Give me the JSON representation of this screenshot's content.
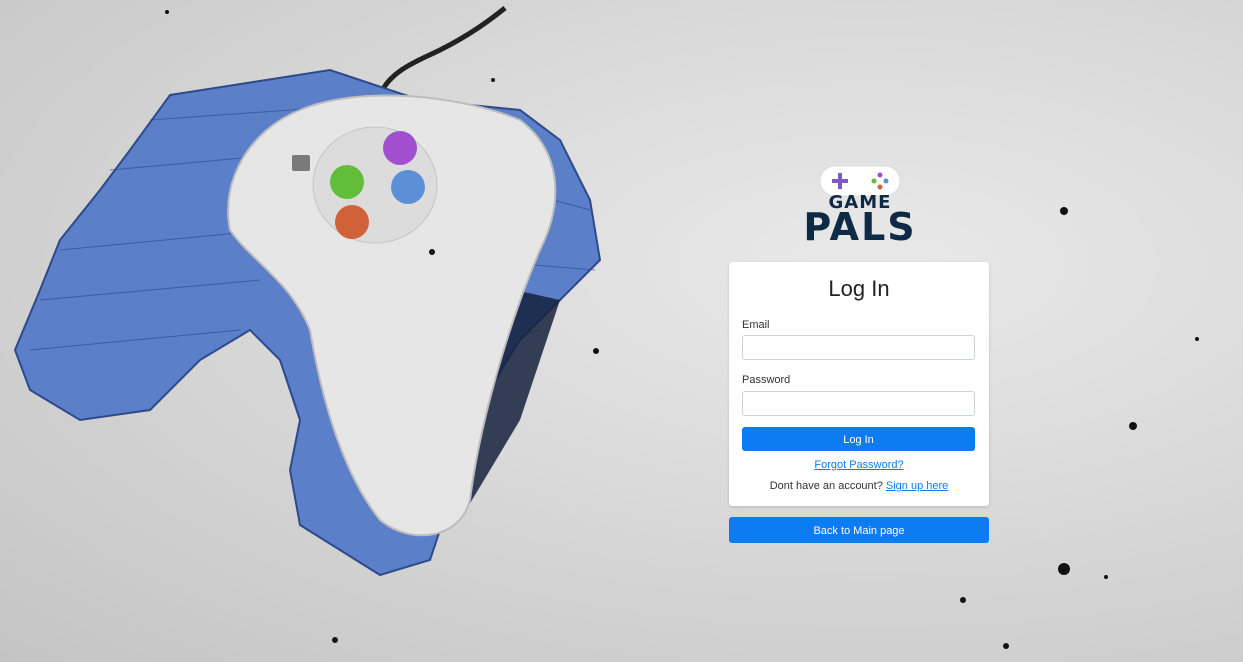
{
  "logo": {
    "line1": "GAME",
    "line2": "PALS"
  },
  "login_card": {
    "title": "Log In",
    "email_label": "Email",
    "email_value": "",
    "password_label": "Password",
    "password_value": "",
    "submit_label": "Log In",
    "forgot_label": "Forgot Password?",
    "signup_prompt": "Dont have an account?",
    "signup_link": "Sign up here"
  },
  "back_button_label": "Back to Main page",
  "colors": {
    "accent": "#0d7cf2",
    "logo_dark": "#0f2a44",
    "controller_cubes": "#5b7fc8"
  }
}
